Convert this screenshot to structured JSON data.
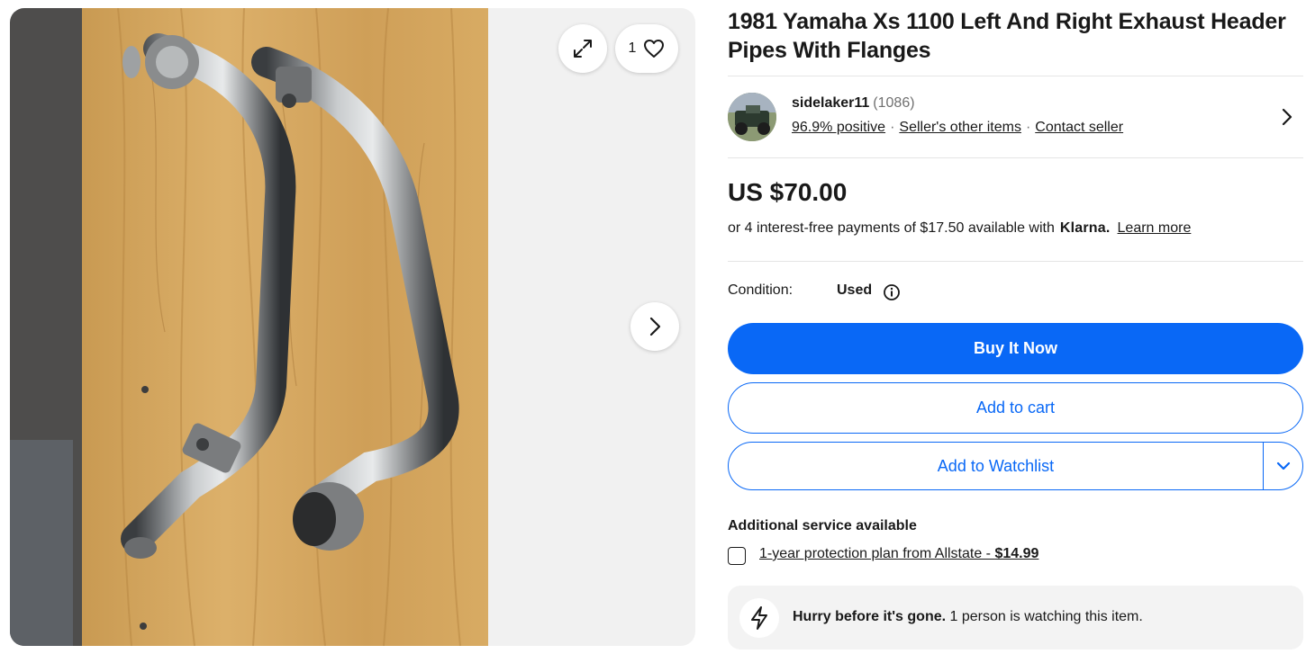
{
  "gallery": {
    "watch_count": "1",
    "icons": {
      "expand": "expand-icon",
      "heart": "heart-icon",
      "next": "chevron-right-icon"
    }
  },
  "listing": {
    "title": "1981 Yamaha Xs 1100 Left And Right Exhaust Header Pipes With Flanges"
  },
  "seller": {
    "name": "sidelaker11",
    "feedback_count": "(1086)",
    "positive": "96.9% positive",
    "other_items": "Seller's other items",
    "contact": "Contact seller"
  },
  "pricing": {
    "price": "US $70.00",
    "installments_text": "or 4 interest-free payments of $17.50 available with",
    "klarna_logo": "Klarna.",
    "learn_more": "Learn more"
  },
  "condition": {
    "label": "Condition:",
    "value": "Used"
  },
  "actions": {
    "buy_now": "Buy It Now",
    "add_to_cart": "Add to cart",
    "add_to_watchlist": "Add to Watchlist"
  },
  "additional_service": {
    "title": "Additional service available",
    "plan_text": "1-year protection plan from Allstate - ",
    "plan_price": "$14.99",
    "checked": false
  },
  "urgency": {
    "strong": "Hurry before it's gone.",
    "text": " 1 person is watching this item."
  },
  "colors": {
    "accent_blue": "#0968f6",
    "text": "#191919",
    "muted": "#707070"
  }
}
